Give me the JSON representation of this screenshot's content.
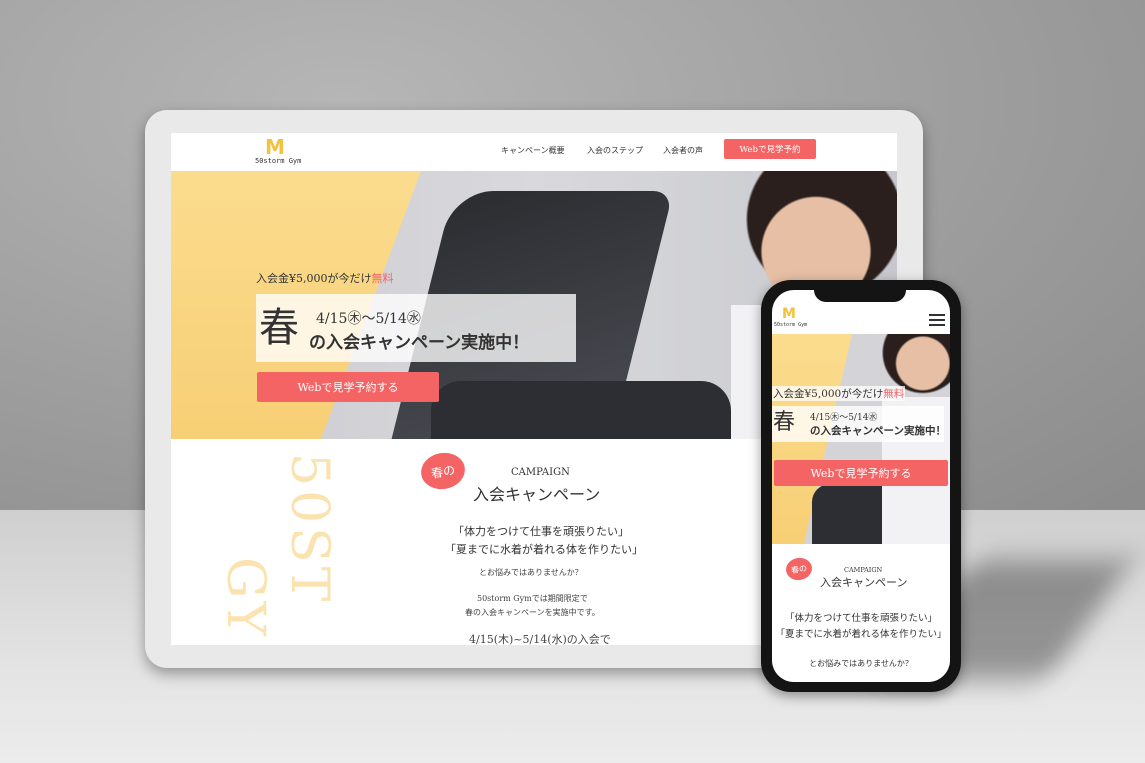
{
  "tablet": {
    "logo_text": "50storm Gym",
    "nav": [
      "キャンペーン概要",
      "入会のステップ",
      "入会者の声"
    ],
    "nav_button": "Webで見学予約",
    "hero": {
      "subtitle_main": "入会金¥5,000が今だけ",
      "subtitle_red": "無料",
      "haru": "春",
      "date_range": "4/15㊍〜5/14㊌",
      "title": "の入会キャンペーン実施中！",
      "cta": "Webで見学予約する"
    },
    "campaign": {
      "badge": "春の",
      "label_en": "CAMPAIGN",
      "title": "入会キャンペーン",
      "quote1": "「体力をつけて仕事を頑張りたい」",
      "quote2": "「夏までに水着が着れる体を作りたい」",
      "question": "とお悩みではありませんか？",
      "line1": "50storm Gymでは期間限定で",
      "line2": "春の入会キャンペーンを実施中です。",
      "period": "4/15(木)~5/14(水)の入会で",
      "watermark1": "50ST",
      "watermark2": "GY"
    }
  },
  "phone": {
    "logo_text": "50storm Gym",
    "hero": {
      "subtitle_main": "入会金¥5,000が今だけ",
      "subtitle_red": "無料",
      "haru": "春",
      "date_range": "4/15㊍〜5/14㊌",
      "title": "の入会キャンペーン実施中！",
      "cta": "Webで見学予約する"
    },
    "campaign": {
      "badge": "春の",
      "label_en": "CAMPAIGN",
      "title": "入会キャンペーン",
      "quote1": "「体力をつけて仕事を頑張りたい」",
      "quote2": "「夏までに水着が着れる体を作りたい」",
      "question": "とお悩みではありませんか？"
    }
  },
  "colors": {
    "accent": "#f56464",
    "yellow": "#f7cf75",
    "logo": "#f3c23e"
  },
  "icons": {
    "logo": "gym-logo-icon",
    "menu": "hamburger-menu-icon"
  }
}
